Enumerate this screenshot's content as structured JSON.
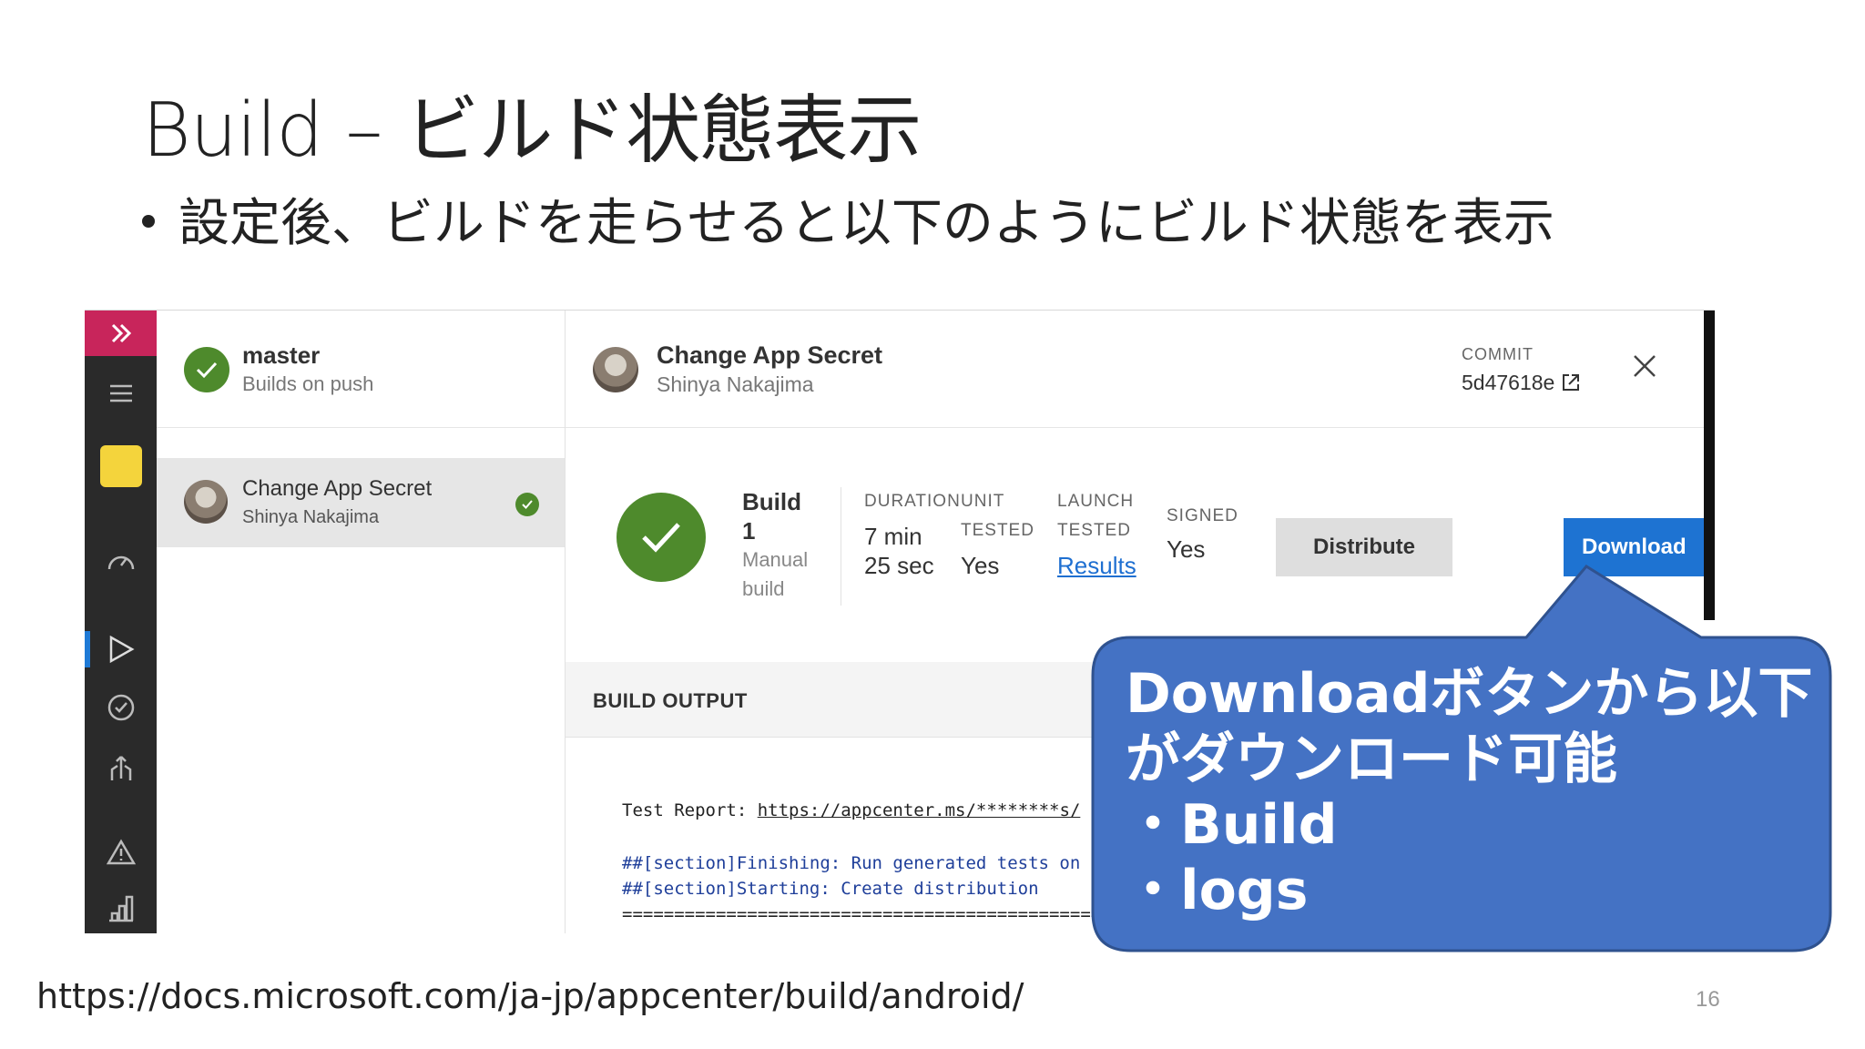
{
  "slide": {
    "title": "Build – ビルド状態表示",
    "bullet": "設定後、ビルドを走らせると以下のようにビルド状態を表示",
    "footer_url": "https://docs.microsoft.com/ja-jp/appcenter/build/android/",
    "page_number": "16"
  },
  "app_ui": {
    "branch": {
      "name": "master",
      "subtitle": "Builds on push"
    },
    "build_item": {
      "title": "Change App Secret",
      "author": "Shinya Nakajima"
    },
    "detail_header": {
      "title": "Change App Secret",
      "author": "Shinya Nakajima",
      "commit_label": "COMMIT",
      "commit_hash": "5d47618e"
    },
    "summary": {
      "build_label_line1": "Build",
      "build_label_line2": "1",
      "build_type_line1": "Manual",
      "build_type_line2": "build",
      "duration_label": "DURATION",
      "duration_line1": "7 min",
      "duration_line2": "25 sec",
      "unit_label_line1": "UNIT",
      "unit_label_line2": "TESTED",
      "unit_value": "Yes",
      "launch_label_line1": "LAUNCH",
      "launch_label_line2": "TESTED",
      "launch_value": "Results",
      "signed_label": "SIGNED",
      "signed_value": "Yes",
      "distribute_button": "Distribute",
      "download_button": "Download"
    },
    "output": {
      "header": "BUILD OUTPUT",
      "report_prefix": "Test Report: ",
      "report_link": "https://appcenter.ms/********s/",
      "line1": "##[section]Finishing: Run generated tests on",
      "line2": "##[section]Starting: Create distribution",
      "line3": "=================================================="
    }
  },
  "callout": {
    "text": "Downloadボタンから以下\nがダウンロード可能\n・Build\n・logs",
    "color": "#4472c4"
  }
}
